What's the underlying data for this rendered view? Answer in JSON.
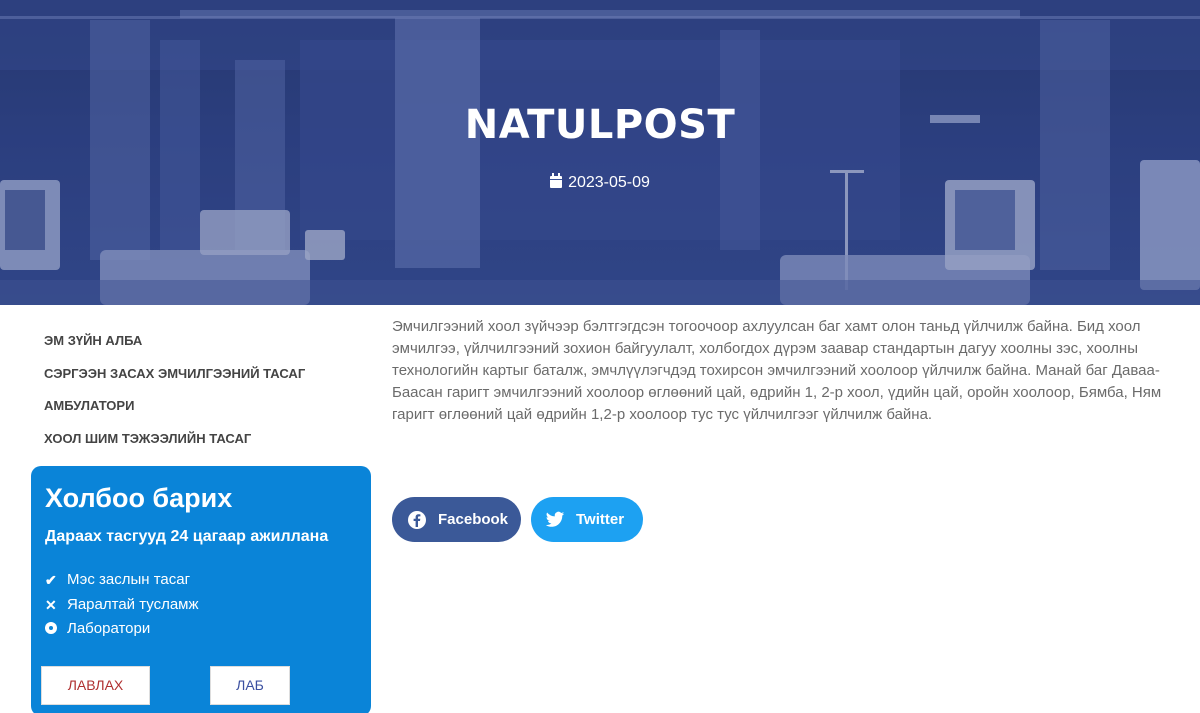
{
  "hero": {
    "title": "NATULPOST",
    "date": "2023-05-09",
    "date_icon": "calendar-icon"
  },
  "side_nav": {
    "items": [
      {
        "label": "ЭМ ЗҮЙН АЛБА"
      },
      {
        "label": "СЭРГЭЭН ЗАСАХ ЭМЧИЛГЭЭНИЙ ТАСАГ"
      },
      {
        "label": "АМБУЛАТОРИ"
      },
      {
        "label": "ХООЛ ШИМ ТЭЖЭЭЛИЙН ТАСАГ"
      }
    ]
  },
  "contact": {
    "title": "Холбоо барих",
    "subtitle": "Дараах тасгууд 24 цагаар ажиллана",
    "items": [
      {
        "label": "Мэс заслын тасаг",
        "icon": "check-icon"
      },
      {
        "label": "Яаралтай тусламж",
        "icon": "cross-icon"
      },
      {
        "label": "Лаборатори",
        "icon": "dot-circle-icon"
      }
    ],
    "buttons": {
      "lavlah": "ЛАВЛАХ",
      "lab": "ЛАБ"
    }
  },
  "article": {
    "body": "Эмчилгээний хоол зүйчээр бэлтгэгдсэн тогоочоор ахлуулсан баг хамт олон таньд үйлчилж байна. Бид хоол эмчилгээ, үйлчилгээний зохион байгуулалт, холбогдох дүрэм заавар стандартын дагуу  хоолны зэс, хоолны технологийн картыг баталж, эмчлүүлэгчдэд тохирсон эмчилгээний хоолоор үйлчилж байна. Манай баг Даваа-Баасан гаригт эмчилгээний хоолоор өглөөний цай, өдрийн 1, 2-р хоол, үдийн цай,  оройн хоолоор, Бямба, Ням гаригт өглөөний цай өдрийн 1,2-р хоолоор тус тус үйлчилгээг үйлчилж байна."
  },
  "share": {
    "facebook": "Facebook",
    "twitter": "Twitter"
  },
  "colors": {
    "hero_blue": "#34488a",
    "contact_blue": "#0a84d8",
    "facebook": "#3b5998",
    "twitter": "#1da1f2"
  }
}
